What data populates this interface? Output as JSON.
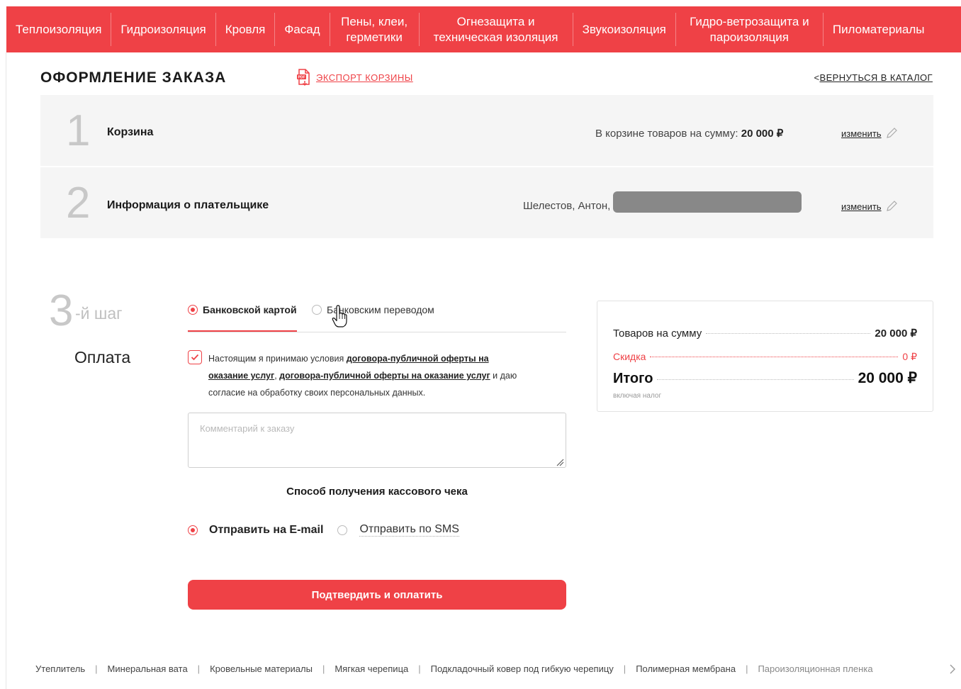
{
  "nav": {
    "items": [
      {
        "label": "Теплоизоляция"
      },
      {
        "label": "Гидроизоляция"
      },
      {
        "label": "Кровля"
      },
      {
        "label": "Фасад"
      },
      {
        "label": "Пены, клеи, герметики"
      },
      {
        "label": "Огнезащита и техническая изоляция"
      },
      {
        "label": "Звукоизоляция"
      },
      {
        "label": "Гидро-ветрозащита и пароизоляция"
      },
      {
        "label": "Пиломатериалы"
      }
    ]
  },
  "header": {
    "title": "ОФОРМЛЕНИЕ ЗАКАЗА",
    "export_label": "ЭКСПОРТ КОРЗИНЫ",
    "back_arrow": "<",
    "back_label": "ВЕРНУТЬСЯ В КАТАЛОГ"
  },
  "steps": {
    "step1": {
      "number": "1",
      "title": "Корзина",
      "summary_prefix": "В корзине товаров на сумму: ",
      "summary_value": "20 000 ₽",
      "edit_label": "изменить"
    },
    "step2": {
      "number": "2",
      "title": "Информация о плательщике",
      "summary": "Шелестов, Антон,",
      "edit_label": "изменить"
    },
    "step3": {
      "number": "3",
      "suffix": "-й шаг",
      "title": "Оплата"
    }
  },
  "payment": {
    "tabs": [
      {
        "label": "Банковской картой",
        "selected": true
      },
      {
        "label": "Банковским переводом",
        "selected": false
      }
    ]
  },
  "consent": {
    "checked": true,
    "text_1": "Настоящим я принимаю условия ",
    "link_1": "договора-публичной оферты на оказание услуг",
    "text_2": ", ",
    "link_2": "договора-публичной оферты на оказание услуг",
    "text_3": " и даю согласие на обработку своих персональных данных."
  },
  "comment": {
    "placeholder": "Комментарий к заказу",
    "value": ""
  },
  "receipt": {
    "title": "Способ получения кассового чека",
    "options": [
      {
        "label": "Отправить на E-mail",
        "selected": true
      },
      {
        "label": "Отправить по SMS",
        "selected": false
      }
    ]
  },
  "confirm_label": "Подтвердить и оплатить",
  "summary": {
    "goods_label": "Товаров на сумму",
    "goods_value": "20 000 ₽",
    "discount_label": "Скидка",
    "discount_value": "0 ₽",
    "total_label": "Итого",
    "total_value": "20 000 ₽",
    "tax_note": "включая налог"
  },
  "footer_tags": [
    "Утеплитель",
    "Минеральная вата",
    "Кровельные материалы",
    "Мягкая черепица",
    "Подкладочный ковер под гибкую черепицу",
    "Полимерная мембрана",
    "Пароизоляционная пленка"
  ],
  "colors": {
    "accent": "#ef4146",
    "step_bg": "#f5f5f5",
    "step_number": "#c8c8c8",
    "redaction": "#888888"
  },
  "icons": {
    "export": "pdf-export-icon",
    "edit": "pencil-icon",
    "cursor": "hand-cursor-icon",
    "check": "checkmark-icon",
    "footer_next": "chevron-right-icon"
  }
}
